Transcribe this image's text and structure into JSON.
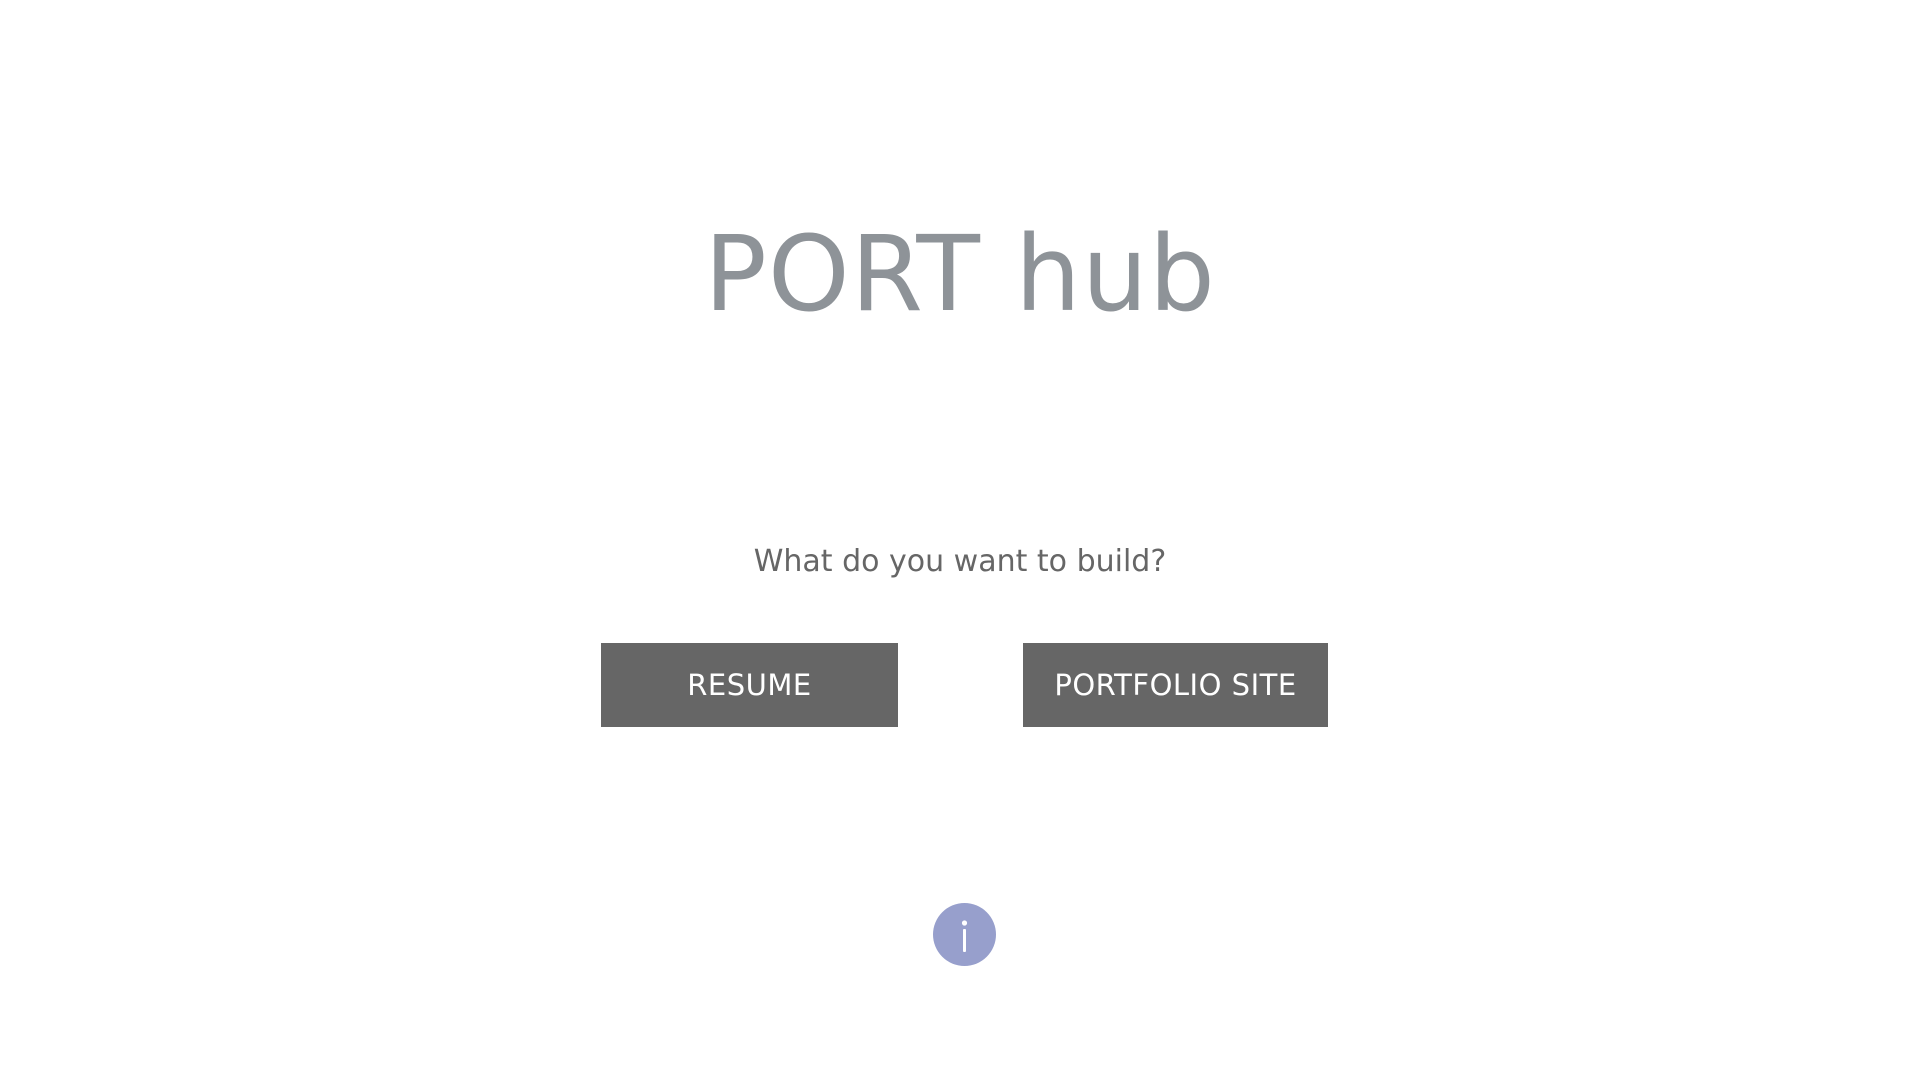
{
  "app": {
    "title": "PORT hub"
  },
  "main": {
    "prompt": "What do you want to build?",
    "buttons": [
      {
        "label": "RESUME"
      },
      {
        "label": "PORTFOLIO SITE"
      }
    ]
  },
  "footer": {
    "info_icon": "info-icon"
  },
  "colors": {
    "title": "#8e9398",
    "button_bg": "#666666",
    "button_text": "#ffffff",
    "info_icon_bg": "#979fcc"
  }
}
